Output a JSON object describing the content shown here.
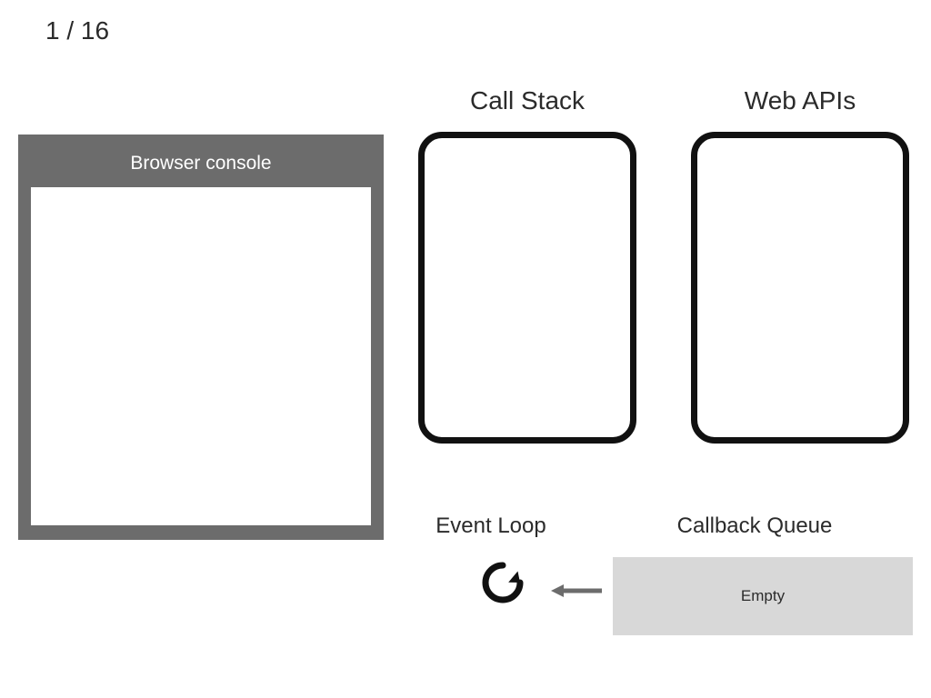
{
  "step": {
    "current": 1,
    "total": 16,
    "label": "1 / 16"
  },
  "panels": {
    "console_title": "Browser console",
    "call_stack_title": "Call Stack",
    "web_apis_title": "Web APIs",
    "event_loop_title": "Event Loop",
    "callback_queue_title": "Callback Queue",
    "callback_queue_content": "Empty"
  },
  "icons": {
    "event_loop": "refresh-loop-icon",
    "queue_to_loop_arrow": "arrow-left-icon"
  },
  "colors": {
    "console_frame": "#6c6c6c",
    "box_border": "#111111",
    "queue_bg": "#d8d8d8",
    "arrow": "#6c6c6c"
  }
}
